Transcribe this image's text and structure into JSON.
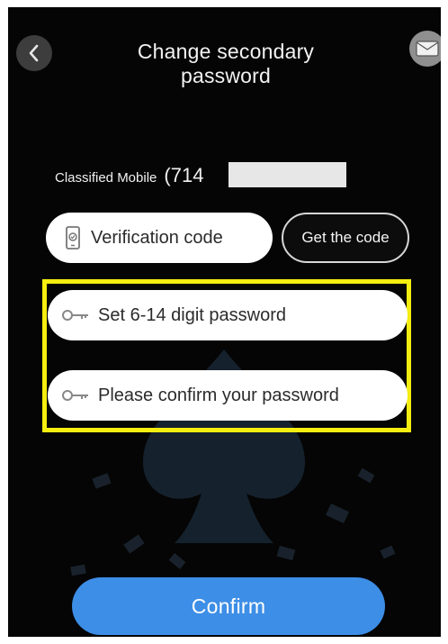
{
  "header": {
    "title": "Change secondary password",
    "back_icon": "chevron-left-icon",
    "mail_icon": "envelope-icon"
  },
  "phone": {
    "label": "Classified Mobile",
    "number_visible": "(714"
  },
  "verification": {
    "placeholder": "Verification code",
    "icon": "phone-verify-icon",
    "get_code_label": "Get the code"
  },
  "password": {
    "new_placeholder": "Set 6-14 digit password",
    "confirm_placeholder": "Please confirm your password",
    "icon": "key-icon",
    "highlight_color": "#f5ee10"
  },
  "confirm_button": {
    "label": "Confirm",
    "color": "#3d8ee6"
  }
}
